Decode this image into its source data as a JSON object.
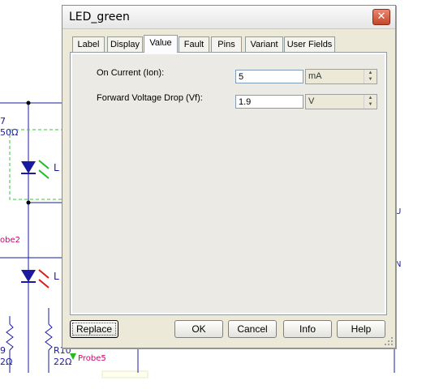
{
  "background": {
    "labels": {
      "res_top": "7",
      "res_top_val": "50Ω",
      "led1_name": "L",
      "led2_name": "L",
      "probe2": "obe2",
      "r_left": "9",
      "r_left_val": "2Ω",
      "r10": "R10",
      "r10_val": "22Ω",
      "probe5": "Probe5",
      "edge_u": "U",
      "edge_n": "N"
    }
  },
  "dialog": {
    "title": "LED_green",
    "close_icon": "close-icon",
    "tabs": [
      {
        "label": "Label"
      },
      {
        "label": "Display"
      },
      {
        "label": "Value",
        "active": true
      },
      {
        "label": "Fault"
      },
      {
        "label": "Pins"
      },
      {
        "label": "Variant"
      },
      {
        "label": "User Fields"
      }
    ],
    "fields": {
      "on_current": {
        "label": "On Current (Ion):",
        "value": "5",
        "unit": "mA"
      },
      "forward_voltage": {
        "label": "Forward Voltage Drop (Vf):",
        "value": "1.9",
        "unit": "V"
      }
    },
    "buttons": {
      "replace": "Replace",
      "ok": "OK",
      "cancel": "Cancel",
      "info": "Info",
      "help": "Help"
    }
  }
}
